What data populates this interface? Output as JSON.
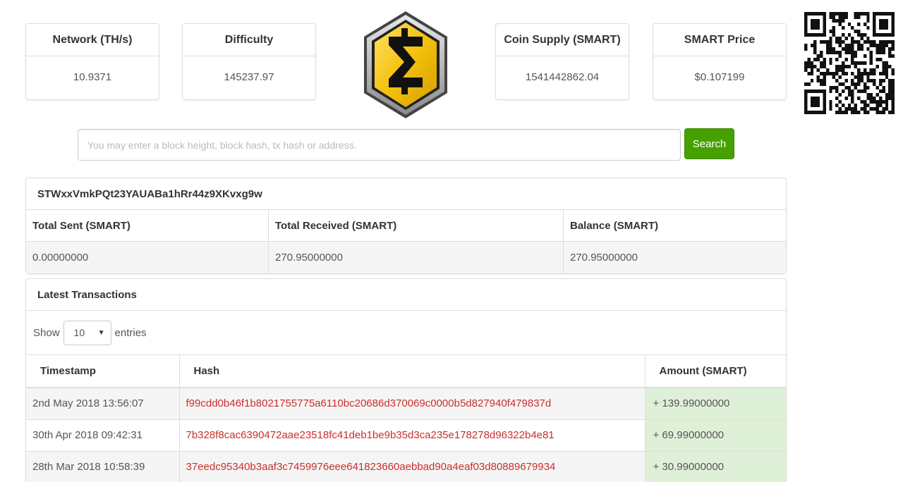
{
  "stats": {
    "network": {
      "label": "Network (TH/s)",
      "value": "10.9371"
    },
    "difficulty": {
      "label": "Difficulty",
      "value": "145237.97"
    },
    "supply": {
      "label": "Coin Supply (SMART)",
      "value": "1541442862.04"
    },
    "price": {
      "label": "SMART Price",
      "value": "$0.107199"
    }
  },
  "logo": {
    "icon": "smartcash-sigma-logo",
    "color": "#f4c20d"
  },
  "qr": {
    "icon": "qr-code-icon"
  },
  "search": {
    "placeholder": "You may enter a block height, block hash, tx hash or address.",
    "button_label": "Search",
    "button_color": "#46a100"
  },
  "address": {
    "id": "STWxxVmkPQt23YAUABa1hRr44z9XKvxg9w",
    "headers": [
      "Total Sent (SMART)",
      "Total Received (SMART)",
      "Balance (SMART)"
    ],
    "values": [
      "0.00000000",
      "270.95000000",
      "270.95000000"
    ]
  },
  "transactions": {
    "title": "Latest Transactions",
    "show_label": "Show",
    "entries_value": "10",
    "entries_label": "entries",
    "columns": [
      "Timestamp",
      "Hash",
      "Amount (SMART)"
    ],
    "rows": [
      {
        "timestamp": "2nd May 2018 13:56:07",
        "hash": "f99cdd0b46f1b8021755775a6110bc20686d370069c0000b5d827940f479837d",
        "amount": "+ 139.99000000"
      },
      {
        "timestamp": "30th Apr 2018 09:42:31",
        "hash": "7b328f8cac6390472aae23518fc41deb1be9b35d3ca235e178278d96322b4e81",
        "amount": "+ 69.99000000"
      },
      {
        "timestamp": "28th Mar 2018 10:58:39",
        "hash": "37eedc95340b3aaf3c7459976eee641823660aebbad90a4eaf03d80889679934",
        "amount": "+ 30.99000000"
      }
    ]
  }
}
